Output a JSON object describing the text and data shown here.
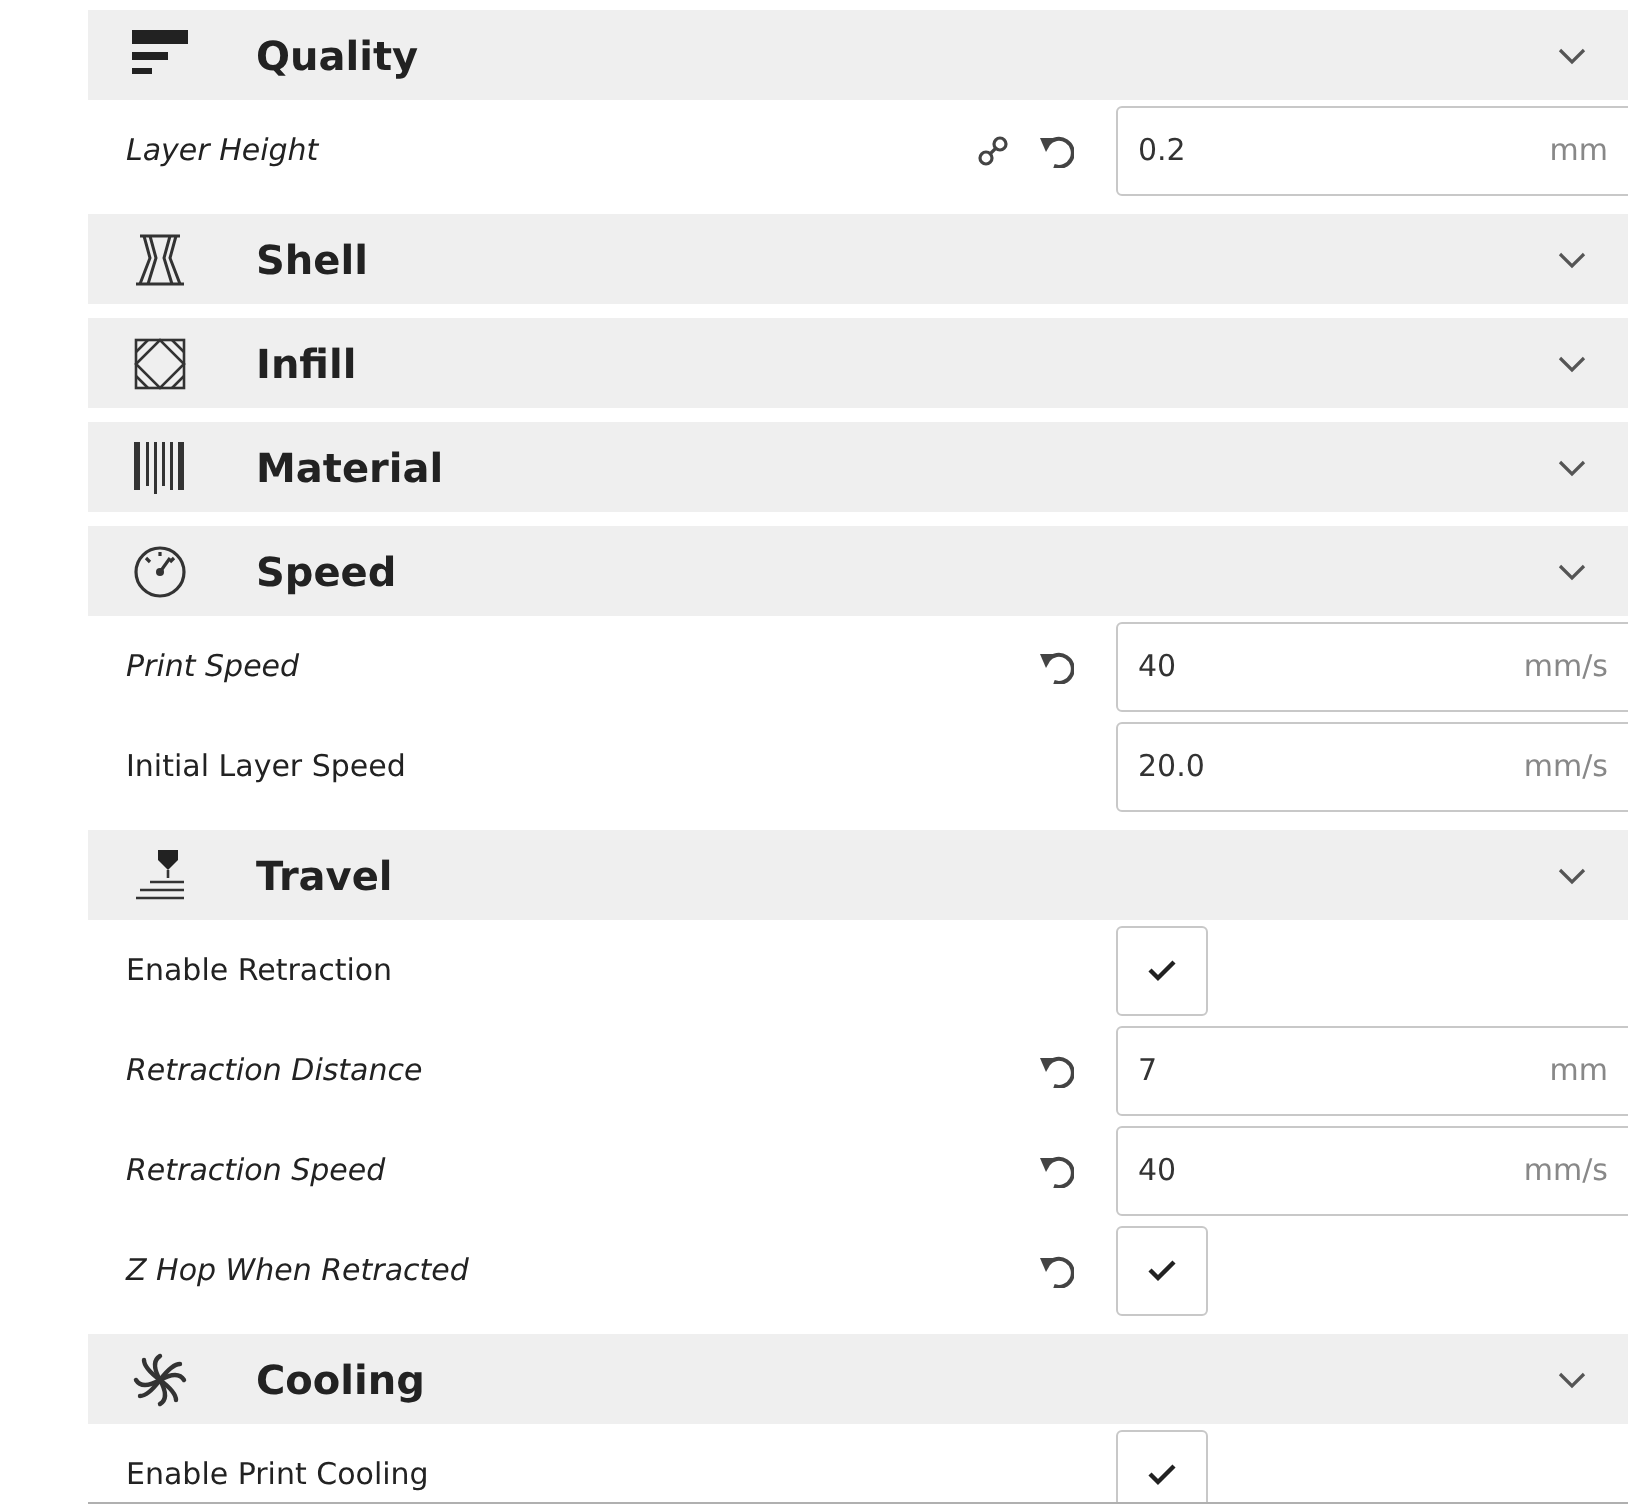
{
  "sections": [
    {
      "title": "Quality",
      "settings": [
        {
          "kind": "number",
          "label": "Layer Height",
          "modified": true,
          "linked": true,
          "value": "0.2",
          "unit": "mm"
        }
      ]
    },
    {
      "title": "Shell"
    },
    {
      "title": "Infill"
    },
    {
      "title": "Material"
    },
    {
      "title": "Speed",
      "settings": [
        {
          "kind": "number",
          "label": "Print Speed",
          "modified": true,
          "linked": false,
          "value": "40",
          "unit": "mm/s"
        },
        {
          "kind": "number",
          "label": "Initial Layer Speed",
          "modified": false,
          "linked": false,
          "value": "20.0",
          "unit": "mm/s"
        }
      ]
    },
    {
      "title": "Travel",
      "settings": [
        {
          "kind": "checkbox",
          "label": "Enable Retraction",
          "modified": false,
          "linked": false,
          "checked": true
        },
        {
          "kind": "number",
          "label": "Retraction Distance",
          "modified": true,
          "linked": false,
          "value": "7",
          "unit": "mm"
        },
        {
          "kind": "number",
          "label": "Retraction Speed",
          "modified": true,
          "linked": false,
          "value": "40",
          "unit": "mm/s"
        },
        {
          "kind": "checkbox",
          "label": "Z Hop When Retracted",
          "modified": true,
          "linked": false,
          "checked": true
        }
      ]
    },
    {
      "title": "Cooling",
      "settings": [
        {
          "kind": "checkbox",
          "label": "Enable Print Cooling",
          "modified": false,
          "linked": false,
          "checked": true
        }
      ]
    }
  ]
}
